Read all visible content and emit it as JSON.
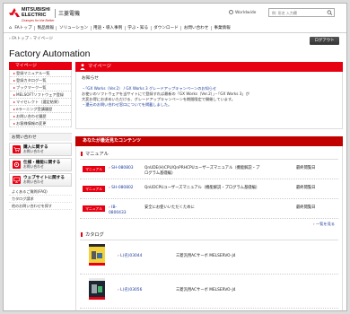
{
  "header": {
    "logo_line1": "MITSUBISHI",
    "logo_line2": "ELECTRIC",
    "logo_tagline": "Changes for the Better",
    "logo_jp": "三菱電機",
    "worldwide": "Worldwide",
    "search_placeholder": "例: 形名 入力欄",
    "accent_color": "#e60012"
  },
  "nav": {
    "home_icon": "home-icon",
    "items": [
      "FAトップ",
      "製品情報",
      "ソリューション",
      "用途・導入事例",
      "学ぶ・知る",
      "ダウンロード",
      "お問い合わせ",
      "事業情報"
    ]
  },
  "breadcrumb": "› FAトップ › マイページ",
  "logout_label": "ログアウト",
  "page_title": "Factory Automation",
  "sidebar": {
    "title": "マイページ",
    "items": [
      "登録マニュアル一覧",
      "登録カタログ一覧",
      "ブックマーク一覧",
      "MELSOFTソフトウェア登録",
      "マイセレクト（選定結果）",
      "eラーニング受講履歴",
      "お問い合わせ履歴",
      "お客様情報の変更"
    ],
    "contact_heading": "お問い合わせ",
    "buttons": [
      {
        "title": "購入に関する",
        "sub": "お問い合わせ",
        "icon": "cart-icon"
      },
      {
        "title": "仕様・機能に関する",
        "sub": "お問い合わせ",
        "icon": "gear-icon"
      },
      {
        "title": "ウェブサイトに関する",
        "sub": "お問い合わせ",
        "icon": "monitor-icon"
      }
    ],
    "links": [
      "よくあるご質問(FAQ)",
      "カタログ請求",
      "他のお問い合わせを探す"
    ]
  },
  "main": {
    "title": "マイページ",
    "notice_title": "お知らせ",
    "notices": [
      "・「GX Works（Ver.2） / GX Works 3 グレードアップキャンペーンのお知らせ",
      "お使いのソフトウェアを当サイトにて登録すれば最新の「GX Works（Ver.2）」・「GX Works 3」が",
      "大変お得にお求めいただける、グレードアップキャンペーンを期間限定で開催しています。",
      "・還元のお問い合わせ窓口についてを掲載しました。"
    ],
    "rec_title": "あなたが最近見たコンテンツ",
    "manual_heading": "マニュアル",
    "badge_label": "マニュアル",
    "manuals": [
      {
        "code": "SH-080803",
        "name": "QnUDE(H)CPU/QnPRHCPUユーザーズマニュアル（機能解説・プログラム基礎編）",
        "date": "最終閲覧日"
      },
      {
        "code": "SH-080802",
        "name": "QnUDCPUユーザーズマニュアル（機能解説・プログラム基礎編）",
        "date": "最終閲覧日"
      },
      {
        "code": "IB-0800433",
        "name": "安全にお使いいただくために",
        "date": "最終閲覧日"
      }
    ],
    "more_label": "一覧を見る",
    "catalog_heading": "カタログ",
    "catalogs": [
      {
        "code": "L(名)03044",
        "name": "三菱汎用ACサーボ MELSERVO-J4"
      },
      {
        "code": "L(名)03056",
        "name": "三菱汎用ACサーボ MELSERVO-J4"
      }
    ]
  }
}
